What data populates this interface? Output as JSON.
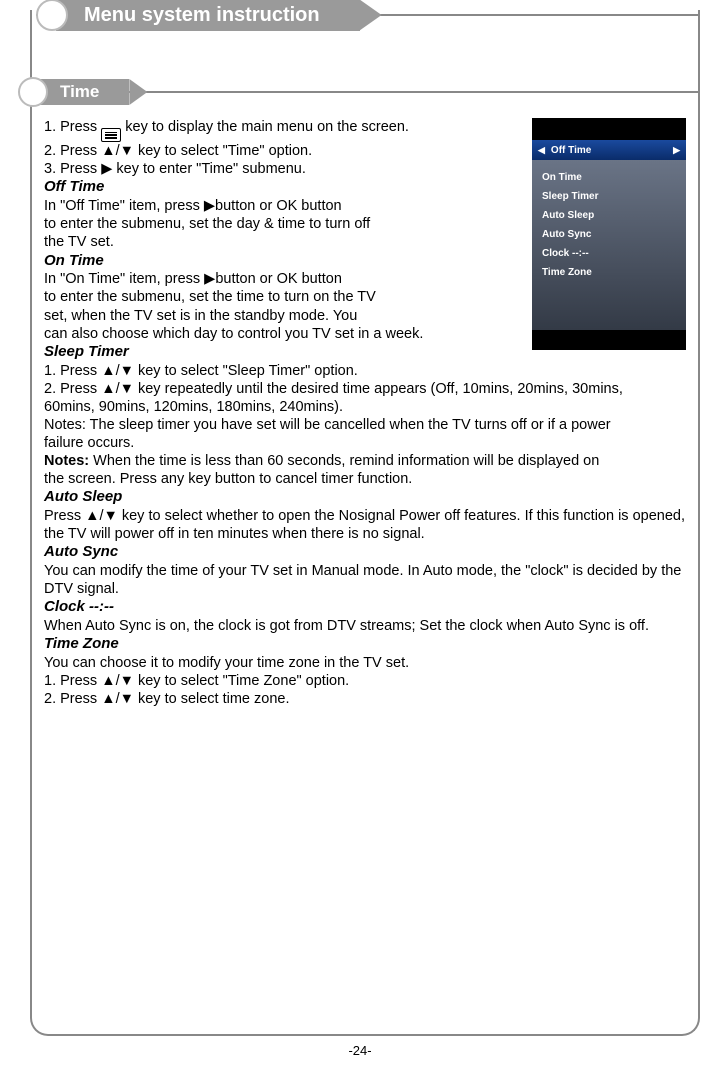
{
  "header": "Menu system instruction",
  "subheader": "Time",
  "page_number": "-24-",
  "intro": {
    "l1a": "1. Press ",
    "l1b": " key to display the main menu on the screen.",
    "l2": "2. Press ▲/▼ key to select \"Time\" option.",
    "l3": "3. Press ▶ key to enter \"Time\" submenu."
  },
  "off_time": {
    "title": " Off Time",
    "l1": "In \"Off Time\" item, press ▶button or OK  button",
    "l2": "to enter the submenu, set the day & time to turn off",
    "l3": "the TV set."
  },
  "on_time": {
    "title": "On Time",
    "l1": "In \"On Time\" item, press ▶button or OK button",
    "l2": "to enter the submenu, set the time to turn on the TV",
    "l3": "set, when the TV set is in the standby mode. You",
    "l4": "can also choose which day to control you TV set in a week."
  },
  "sleep_timer": {
    "title": "Sleep Timer",
    "l1": "1. Press ▲/▼ key to select \"Sleep Timer\" option.",
    "l2": "2. Press ▲/▼ key repeatedly until the desired time appears (Off, 10mins, 20mins, 30mins,",
    "l2b": "    60mins, 90mins, 120mins, 180mins, 240mins).",
    "l3": "Notes: The sleep timer you have set will be cancelled when the TV turns off or if a power",
    "l3b": "failure occurs.",
    "notes_label": "Notes:",
    "l4": " When the time is less than 60 seconds, remind information will be displayed on",
    "l4b": "             the screen. Press any key button to cancel timer function."
  },
  "auto_sleep": {
    "title": "Auto Sleep",
    "l1": "Press ▲/▼ key to select whether to open the Nosignal Power off features. If this function is opened, the TV will power off  in ten minutes when there is no signal."
  },
  "auto_sync": {
    "title": "Auto Sync",
    "l1": "You can modify the time of your TV set in Manual mode. In Auto mode, the \"clock\" is decided by the DTV signal."
  },
  "clock": {
    "title": "Clock --:--",
    "l1": "When Auto Sync is on, the clock is got from DTV streams; Set the clock when Auto Sync is off."
  },
  "time_zone": {
    "title": "Time Zone",
    "l1": "You can choose it to modify your time zone in the TV set.",
    "l2": "1. Press ▲/▼ key to select \"Time Zone\" option.",
    "l3": "2. Press ▲/▼ key to select time zone."
  },
  "thumbnail": {
    "selected": "Off Time",
    "items": [
      "On Time",
      "Sleep Timer",
      "Auto Sleep",
      "Auto Sync",
      "Clock --:--",
      "Time Zone"
    ],
    "left_arrow": "◀",
    "right_arrow": "▶"
  }
}
